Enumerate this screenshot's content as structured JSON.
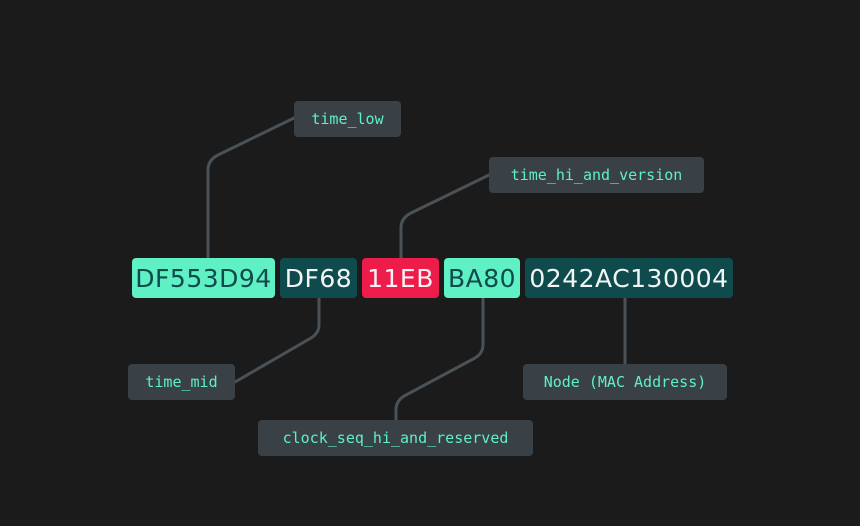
{
  "uuid_segments": [
    {
      "id": "time_low",
      "text": "DF553D94",
      "bg": "#5ff0c4",
      "fg": "#0f4b4d"
    },
    {
      "id": "time_mid",
      "text": "DF68",
      "bg": "#0f4b4d",
      "fg": "#f2f5f5"
    },
    {
      "id": "time_hi_and_version",
      "text": "11EB",
      "bg": "#ed1c4a",
      "fg": "#fff2f4"
    },
    {
      "id": "clock_seq_hi_and_reserved",
      "text": "BA80",
      "bg": "#5ff0c4",
      "fg": "#0f4b4d"
    },
    {
      "id": "node",
      "text": "0242AC130004",
      "bg": "#0f4b4d",
      "fg": "#f2f5f5"
    }
  ],
  "labels": {
    "time_low": "time_low",
    "time_mid": "time_mid",
    "time_hi_and_version": "time_hi_and_version",
    "clock_seq_hi_and_reserved": "clock_seq_hi_and_reserved",
    "node": "Node (MAC Address)"
  },
  "colors": {
    "background": "#1b1b1b",
    "label_bg": "#3a4146",
    "label_text": "#5ff0c4",
    "connector": "#4a5257"
  }
}
